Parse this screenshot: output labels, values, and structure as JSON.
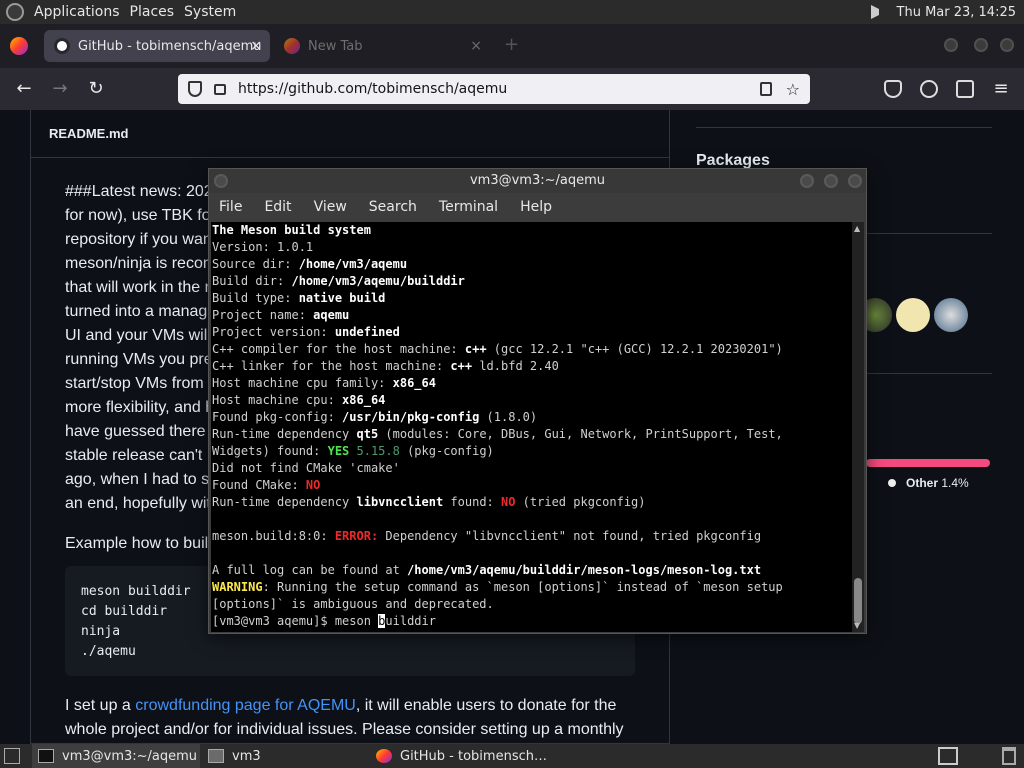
{
  "panel": {
    "menus": [
      "Applications",
      "Places",
      "System"
    ],
    "clock": "Thu Mar 23, 14:25"
  },
  "browser": {
    "tabs": [
      {
        "title": "GitHub - tobimensch/aqemu",
        "close": "×"
      },
      {
        "title": "New Tab",
        "close": "×"
      }
    ],
    "new_tab": "+",
    "url": "https://github.com/tobimensch/aqemu"
  },
  "readme": {
    "header": "README.md",
    "lines": [
      "###Latest news: 202",
      "for now), use TBK fo",
      "repository if you wan",
      "meson/ninja is recom",
      "that will work in the n",
      "turned into a manag",
      "UI and your VMs wil",
      "running VMs you pre",
      "start/stop VMs from",
      "more flexibility, and h",
      "have guessed there",
      "stable release can't",
      "ago, when I had to s",
      "an end, hopefully wit"
    ],
    "example": "Example how to buil",
    "code": [
      "meson builddir",
      "cd builddir",
      "ninja",
      "./aqemu"
    ],
    "funding_pre": "I set up a ",
    "funding_link": "crowdfunding page for AQEMU",
    "funding_post": ", it will enable users to donate for the",
    "funding_line2": "whole project and/or for individual issues. Please consider setting up a monthly"
  },
  "sidebar": {
    "packages": "Packages",
    "other_lang": "Other",
    "other_pct": "1.4%"
  },
  "terminal": {
    "title": "vm3@vm3:~/aqemu",
    "menu": [
      "File",
      "Edit",
      "View",
      "Search",
      "Terminal",
      "Help"
    ],
    "lines": [
      [
        {
          "t": "The Meson build system",
          "c": "b"
        }
      ],
      [
        {
          "t": "Version: 1.0.1",
          "c": ""
        }
      ],
      [
        {
          "t": "Source dir: ",
          "c": ""
        },
        {
          "t": "/home/vm3/aqemu",
          "c": "b"
        }
      ],
      [
        {
          "t": "Build dir: ",
          "c": ""
        },
        {
          "t": "/home/vm3/aqemu/builddir",
          "c": "b"
        }
      ],
      [
        {
          "t": "Build type: ",
          "c": ""
        },
        {
          "t": "native build",
          "c": "b"
        }
      ],
      [
        {
          "t": "Project name: ",
          "c": ""
        },
        {
          "t": "aqemu",
          "c": "b"
        }
      ],
      [
        {
          "t": "Project version: ",
          "c": ""
        },
        {
          "t": "undefined",
          "c": "b"
        }
      ],
      [
        {
          "t": "C++ compiler for the host machine: ",
          "c": ""
        },
        {
          "t": "c++",
          "c": "b"
        },
        {
          "t": " (gcc 12.2.1 \"c++ (GCC) 12.2.1 20230201\")",
          "c": ""
        }
      ],
      [
        {
          "t": "C++ linker for the host machine: ",
          "c": ""
        },
        {
          "t": "c++",
          "c": "b"
        },
        {
          "t": " ld.bfd 2.40",
          "c": ""
        }
      ],
      [
        {
          "t": "Host machine cpu family: ",
          "c": ""
        },
        {
          "t": "x86_64",
          "c": "b"
        }
      ],
      [
        {
          "t": "Host machine cpu: ",
          "c": ""
        },
        {
          "t": "x86_64",
          "c": "b"
        }
      ],
      [
        {
          "t": "Found pkg-config: ",
          "c": ""
        },
        {
          "t": "/usr/bin/pkg-config",
          "c": "b"
        },
        {
          "t": " (1.8.0)",
          "c": ""
        }
      ],
      [
        {
          "t": "Run-time dependency ",
          "c": ""
        },
        {
          "t": "qt5",
          "c": "b"
        },
        {
          "t": " (modules: Core, DBus, Gui, Network, PrintSupport, Test,",
          "c": ""
        }
      ],
      [
        {
          "t": "Widgets) found: ",
          "c": ""
        },
        {
          "t": "YES",
          "c": "green"
        },
        {
          "t": " 5.15.8",
          "c": "dim"
        },
        {
          "t": " (pkg-config)",
          "c": ""
        }
      ],
      [
        {
          "t": "Did not find CMake 'cmake'",
          "c": ""
        }
      ],
      [
        {
          "t": "Found CMake: ",
          "c": ""
        },
        {
          "t": "NO",
          "c": "red"
        }
      ],
      [
        {
          "t": "Run-time dependency ",
          "c": ""
        },
        {
          "t": "libvncclient",
          "c": "b"
        },
        {
          "t": " found: ",
          "c": ""
        },
        {
          "t": "NO",
          "c": "red"
        },
        {
          "t": " (tried pkgconfig)",
          "c": ""
        }
      ],
      [
        {
          "t": "",
          "c": ""
        }
      ],
      [
        {
          "t": "meson.build:8:0: ",
          "c": ""
        },
        {
          "t": "ERROR:",
          "c": "red"
        },
        {
          "t": " Dependency \"libvncclient\" not found, tried pkgconfig",
          "c": ""
        }
      ],
      [
        {
          "t": "",
          "c": ""
        }
      ],
      [
        {
          "t": "A full log can be found at ",
          "c": ""
        },
        {
          "t": "/home/vm3/aqemu/builddir/meson-logs/meson-log.txt",
          "c": "b"
        }
      ],
      [
        {
          "t": "WARNING",
          "c": "yellow"
        },
        {
          "t": ": Running the setup command as `meson [options]` instead of `meson setup",
          "c": ""
        }
      ],
      [
        {
          "t": "[options]` is ambiguous and deprecated.",
          "c": ""
        }
      ],
      [
        {
          "t": "[vm3@vm3 aqemu]$ meson ",
          "c": ""
        },
        {
          "t": "b",
          "c": "cursor"
        },
        {
          "t": "uilddir",
          "c": ""
        }
      ]
    ]
  },
  "taskbar": {
    "items": [
      "vm3@vm3:~/aqemu",
      "vm3",
      "GitHub - tobimensch…"
    ]
  }
}
